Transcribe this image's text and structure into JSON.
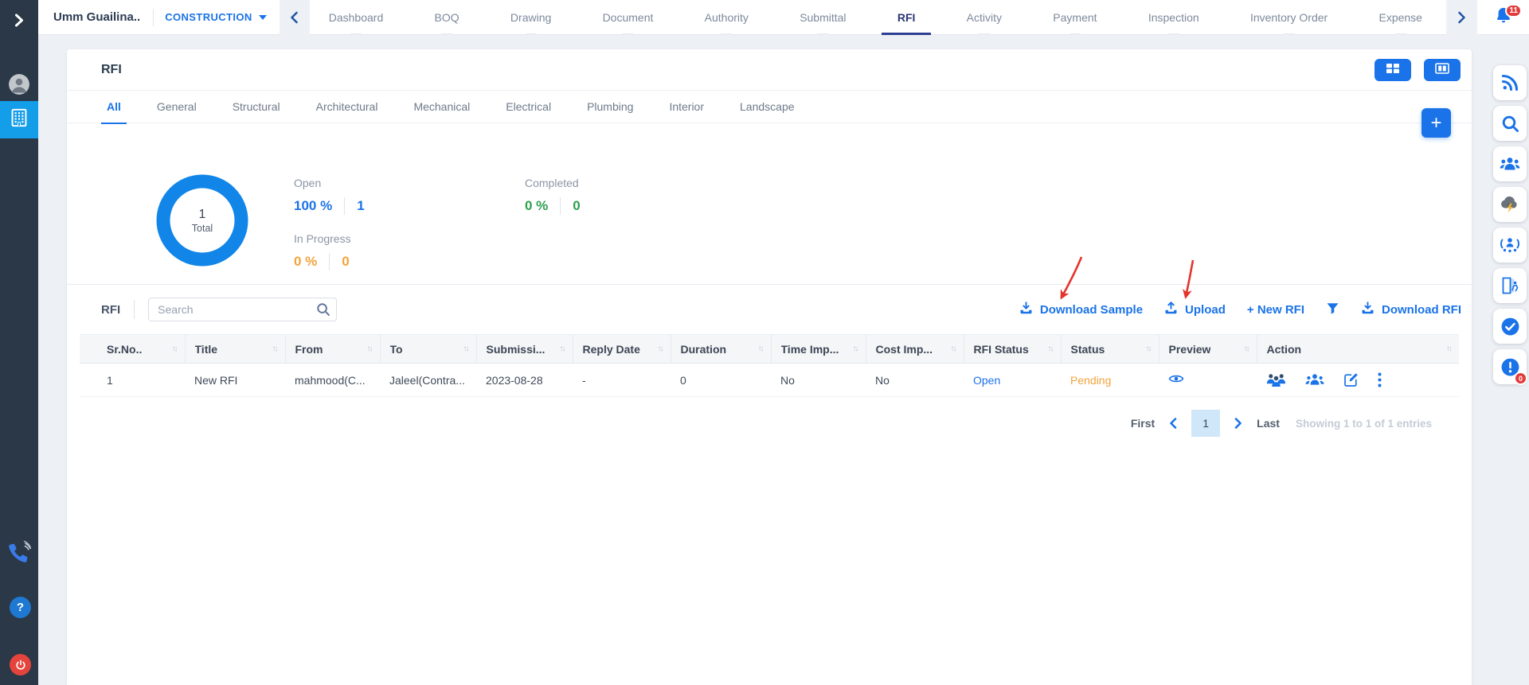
{
  "colors": {
    "accent_blue": "#1a73e8",
    "active_nav_blue": "#2d3f92",
    "sidebar_bg": "#2b3848",
    "sidebar_active_tile": "#149de8",
    "donut_blue": "#1186e8",
    "orange": "#f2a33c",
    "green": "#2e9e4f",
    "badge_red": "#e23b3b",
    "annotation_red": "#e5342c",
    "table_header_bg": "#f4f6f8"
  },
  "sidebar": {
    "icons": [
      "expand-chevron",
      "user-avatar",
      "building",
      "phone-support",
      "help",
      "power"
    ]
  },
  "topbar": {
    "project_name": "Umm Guailina..",
    "module": "CONSTRUCTION",
    "tabs": [
      "Dashboard",
      "BOQ",
      "Drawing",
      "Document",
      "Authority",
      "Submittal",
      "RFI",
      "Activity",
      "Payment",
      "Inspection",
      "Inventory Order",
      "Expense"
    ],
    "active_tab": "RFI",
    "notifications": "11"
  },
  "rightbar": {
    "icons": [
      "rss-feed",
      "search",
      "users",
      "storm-weather",
      "meeting",
      "door-exit",
      "check-circle",
      "alert-circle"
    ],
    "alert_badge": "0"
  },
  "rfi": {
    "title": "RFI",
    "category_tabs": [
      "All",
      "General",
      "Structural",
      "Architectural",
      "Mechanical",
      "Electrical",
      "Plumbing",
      "Interior",
      "Landscape"
    ],
    "active_category": "All",
    "summary": {
      "total": "1",
      "total_label": "Total",
      "donut_percent_open": 100,
      "open_label": "Open",
      "open_percent": "100 %",
      "open_count": "1",
      "inprogress_label": "In Progress",
      "inprogress_percent": "0 %",
      "inprogress_count": "0",
      "completed_label": "Completed",
      "completed_percent": "0 %",
      "completed_count": "0"
    },
    "toolbar": {
      "section_label": "RFI",
      "search_placeholder": "Search",
      "download_sample": "Download Sample",
      "upload": "Upload",
      "new_rfi": "+ New RFI",
      "download_rfi": "Download RFI"
    },
    "table": {
      "columns": [
        "Sr.No..",
        "Title",
        "From",
        "To",
        "Submissi...",
        "Reply Date",
        "Duration",
        "Time Imp...",
        "Cost Imp...",
        "RFI Status",
        "Status",
        "Preview",
        "Action"
      ],
      "row": {
        "sr": "1",
        "title": "New RFI",
        "from": "mahmood(C...",
        "to": "Jaleel(Contra...",
        "submission": "2023-08-28",
        "reply_date": "-",
        "duration": "0",
        "time_impact": "No",
        "cost_impact": "No",
        "rfi_status": "Open",
        "status": "Pending"
      },
      "row_action_icons": [
        "assign-users",
        "team-users",
        "edit",
        "more-kebab"
      ]
    },
    "pagination": {
      "first": "First",
      "page": "1",
      "last": "Last",
      "summary": "Showing 1 to 1 of 1 entries"
    }
  }
}
